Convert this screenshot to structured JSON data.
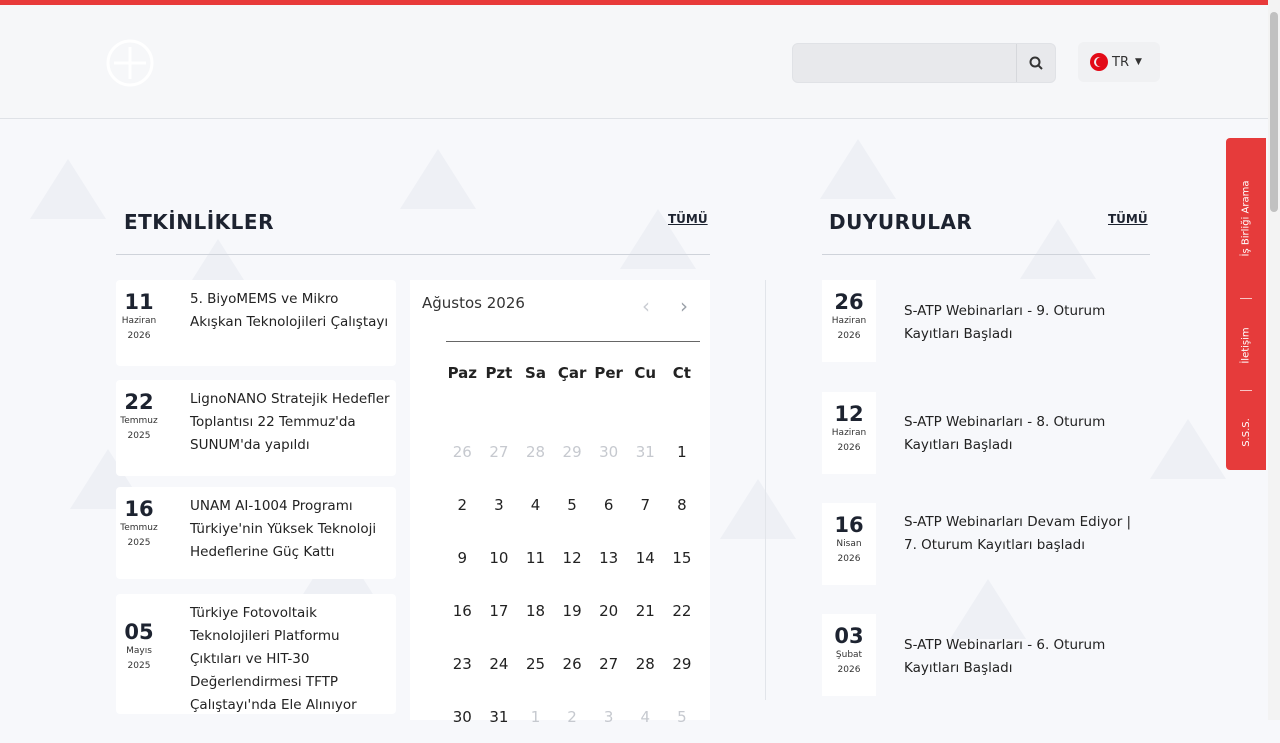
{
  "header": {
    "search": {
      "placeholder": ""
    },
    "language": {
      "code": "TR"
    }
  },
  "events": {
    "title": "ETKİNLİKLER",
    "see_all": "TÜMÜ",
    "items": [
      {
        "day": "11",
        "month": "Haziran",
        "year": "2026",
        "title": "5. BiyoMEMS ve Mikro Akışkan Teknolojileri Çalıştayı"
      },
      {
        "day": "22",
        "month": "Temmuz",
        "year": "2025",
        "title": "LignoNANO Stratejik Hedefler Toplantısı 22 Temmuz'da SUNUM'da yapıldı"
      },
      {
        "day": "16",
        "month": "Temmuz",
        "year": "2025",
        "title": "UNAM AI-1004 Programı Türkiye'nin Yüksek Teknoloji Hedeflerine Güç Kattı"
      },
      {
        "day": "05",
        "month": "Mayıs",
        "year": "2025",
        "title": "Türkiye Fotovoltaik Teknolojileri Platformu Çıktıları ve HIT-30 Değerlendirmesi TFTP Çalıştayı'nda Ele Alınıyor"
      }
    ]
  },
  "calendar": {
    "month_label": "Ağustos 2026",
    "weekdays": [
      "Paz",
      "Pzt",
      "Sa",
      "Çar",
      "Per",
      "Cu",
      "Ct"
    ],
    "weeks": [
      [
        "26",
        "27",
        "28",
        "29",
        "30",
        "31",
        "1"
      ],
      [
        "2",
        "3",
        "4",
        "5",
        "6",
        "7",
        "8"
      ],
      [
        "9",
        "10",
        "11",
        "12",
        "13",
        "14",
        "15"
      ],
      [
        "16",
        "17",
        "18",
        "19",
        "20",
        "21",
        "22"
      ],
      [
        "23",
        "24",
        "25",
        "26",
        "27",
        "28",
        "29"
      ],
      [
        "30",
        "31",
        "1",
        "2",
        "3",
        "4",
        "5"
      ]
    ],
    "muted": [
      [
        true,
        true,
        true,
        true,
        true,
        true,
        false
      ],
      [
        false,
        false,
        false,
        false,
        false,
        false,
        false
      ],
      [
        false,
        false,
        false,
        false,
        false,
        false,
        false
      ],
      [
        false,
        false,
        false,
        false,
        false,
        false,
        false
      ],
      [
        false,
        false,
        false,
        false,
        false,
        false,
        false
      ],
      [
        false,
        false,
        true,
        true,
        true,
        true,
        true
      ]
    ]
  },
  "announcements": {
    "title": "DUYURULAR",
    "see_all": "TÜMÜ",
    "items": [
      {
        "day": "26",
        "month": "Haziran",
        "year": "2026",
        "title": "S-ATP Webinarları - 9. Oturum Kayıtları Başladı"
      },
      {
        "day": "12",
        "month": "Haziran",
        "year": "2026",
        "title": "S-ATP Webinarları - 8. Oturum Kayıtları Başladı"
      },
      {
        "day": "16",
        "month": "Nisan",
        "year": "2026",
        "title": "S-ATP Webinarları Devam Ediyor | 7. Oturum Kayıtları başladı"
      },
      {
        "day": "03",
        "month": "Şubat",
        "year": "2026",
        "title": "S-ATP Webinarları - 6. Oturum Kayıtları Başladı"
      }
    ]
  },
  "side_tab": {
    "items": [
      "İş Birliği Arama",
      "İletişim",
      "S.S.S."
    ]
  },
  "colors": {
    "accent": "#e63b3b",
    "background": "#f7f8fb"
  }
}
